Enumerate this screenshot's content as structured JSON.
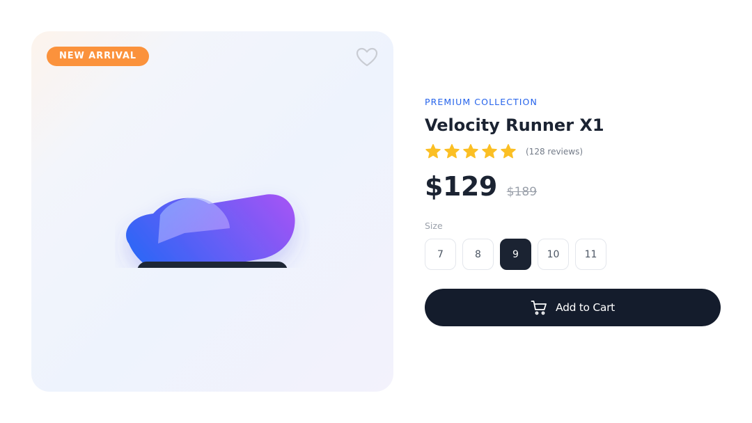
{
  "product_image": {
    "badge": "NEW ARRIVAL",
    "wishlist_icon": "heart-outline-icon"
  },
  "details": {
    "collection": "PREMIUM COLLECTION",
    "title": "Velocity Runner X1",
    "rating": {
      "stars": 5,
      "max": 5,
      "reviews": "(128 reviews)"
    },
    "price": "$129",
    "original_price": "$189",
    "size_label": "Size",
    "sizes": [
      "7",
      "8",
      "9",
      "10",
      "11"
    ],
    "selected_size": "9",
    "add_to_cart": {
      "label": "Add to Cart",
      "icon": "shopping-cart-icon"
    }
  },
  "colors": {
    "accent": "#2563eb",
    "badge": "#fb923c",
    "star": "#fbbf24",
    "dark": "#141c2c"
  }
}
